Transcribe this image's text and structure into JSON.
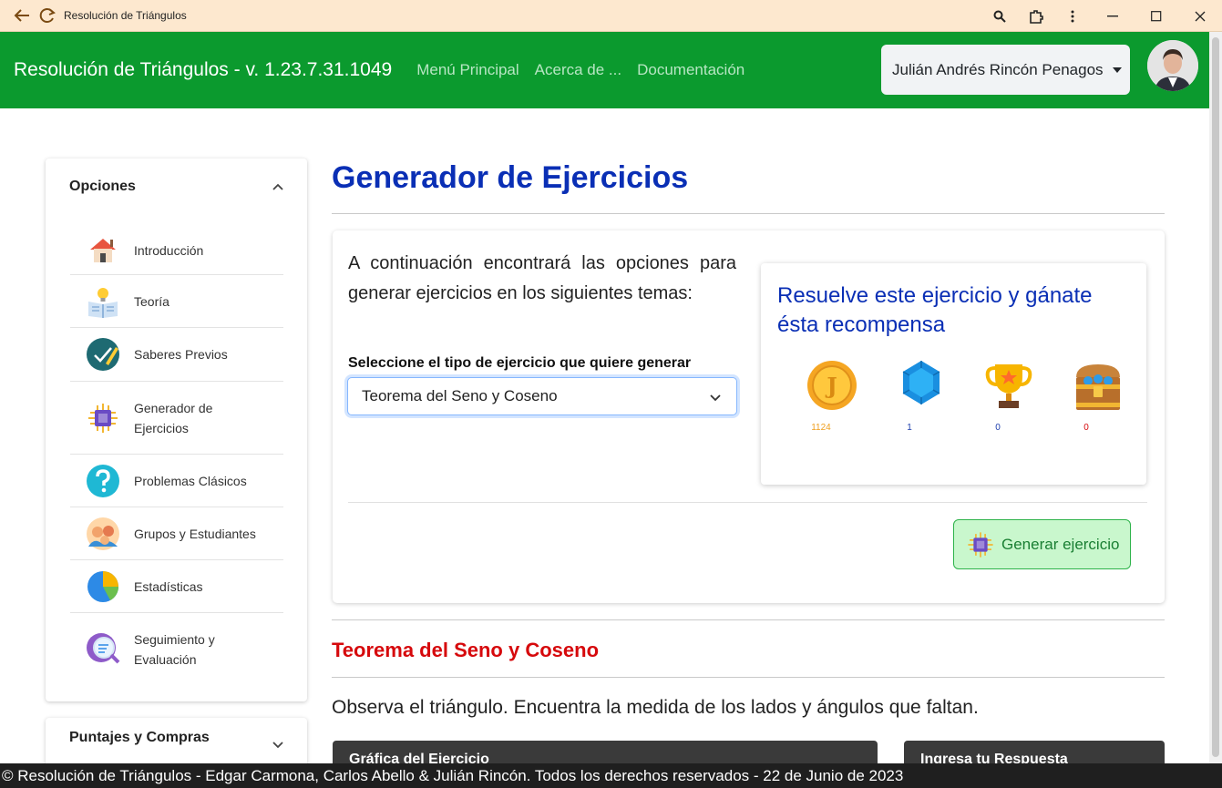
{
  "window": {
    "title": "Resolución de Triángulos"
  },
  "navbar": {
    "brand": "Resolución de Triángulos - v. 1.23.7.31.1049",
    "links": [
      "Menú Principal",
      "Acerca de ...",
      "Documentación"
    ],
    "user": "Julián Andrés Rincón Penagos"
  },
  "sidebar": {
    "title": "Opciones",
    "items": [
      {
        "label": "Introducción",
        "icon": "house-icon"
      },
      {
        "label": "Teoría",
        "icon": "book-lightbulb-icon"
      },
      {
        "label": "Saberes Previos",
        "icon": "pencil-check-icon"
      },
      {
        "label": "Generador de Ejercicios",
        "icon": "chip-icon"
      },
      {
        "label": "Problemas Clásicos",
        "icon": "question-icon"
      },
      {
        "label": "Grupos y Estudiantes",
        "icon": "people-icon"
      },
      {
        "label": "Estadísticas",
        "icon": "pie-chart-icon"
      },
      {
        "label": "Seguimiento y Evaluación",
        "icon": "magnifier-icon"
      }
    ],
    "second_section": "Puntajes y Compras"
  },
  "main": {
    "title": "Generador de Ejercicios",
    "intro": "A continuación encontrará las opciones para generar ejercicios en los siguientes temas:",
    "select_label": "Seleccione el tipo de ejercicio que quiere generar",
    "select_value": "Teorema del Seno y Coseno",
    "reward_title": "Resuelve este ejercicio y gánate ésta recompensa",
    "rewards": [
      {
        "icon": "coin-icon",
        "value": "1124",
        "color": "#f0a020"
      },
      {
        "icon": "gem-icon",
        "value": "1",
        "color": "#1f3fae"
      },
      {
        "icon": "trophy-icon",
        "value": "0",
        "color": "#1f3fae"
      },
      {
        "icon": "treasure-chest-icon",
        "value": "0",
        "color": "#d6090c"
      }
    ],
    "generate_button": "Generar ejercicio",
    "section_title": "Teorema del Seno y Coseno",
    "instruction": "Observa el triángulo. Encuentra la medida de los lados y ángulos que faltan.",
    "graph_card_title": "Gráfica del Ejercicio",
    "answer_card_title": "Ingresa tu Respuesta"
  },
  "footer": "© Resolución de Triángulos - Edgar Carmona, Carlos Abello & Julián Rincón. Todos los derechos reservados - 22 de Junio de 2023",
  "colors": {
    "navbar": "#0b9a2e",
    "title_blue": "#0a2fb5",
    "section_red": "#d6090c"
  }
}
